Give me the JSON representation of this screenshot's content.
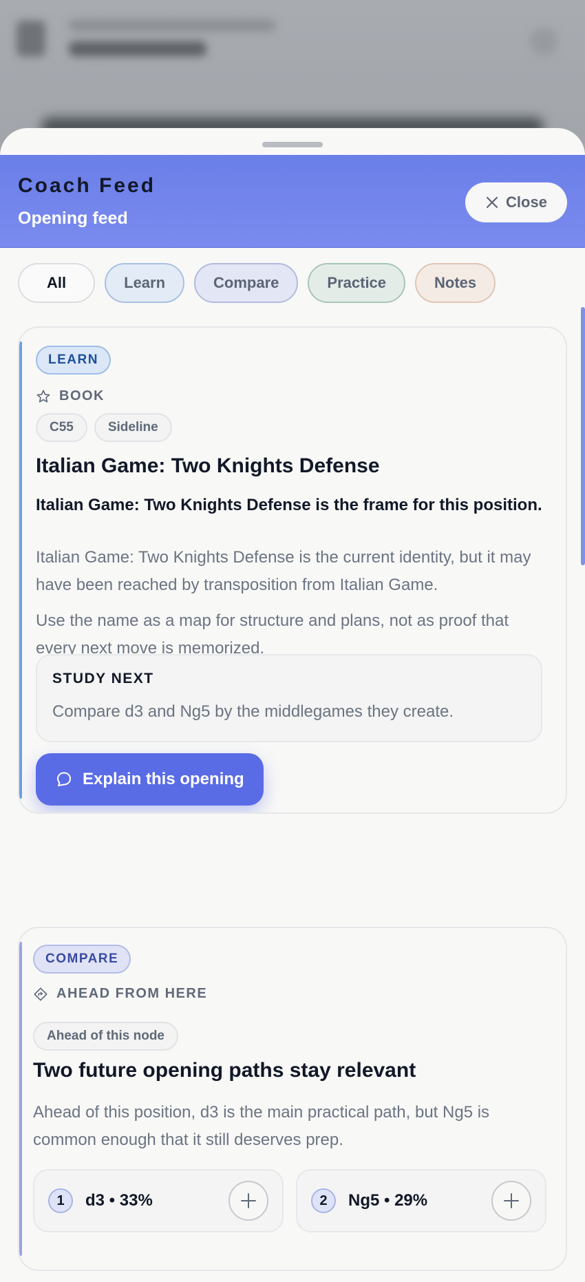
{
  "header": {
    "title": "Coach Feed",
    "subtitle": "Opening feed",
    "close_label": "Close"
  },
  "filters": [
    {
      "label": "All"
    },
    {
      "label": "Learn"
    },
    {
      "label": "Compare"
    },
    {
      "label": "Practice"
    },
    {
      "label": "Notes"
    }
  ],
  "learn_card": {
    "tag": "LEARN",
    "meta": "BOOK",
    "pills": [
      "C55",
      "Sideline"
    ],
    "title": "Italian Game: Two Knights Defense",
    "lead": "Italian Game: Two Knights Defense is the frame for this position.",
    "para1": "Italian Game: Two Knights Defense is the current identity, but it may have been reached by transposition from Italian Game.",
    "para2": "Use the name as a map for structure and plans, not as proof that every next move is memorized.",
    "study_title": "STUDY NEXT",
    "study_text": "Compare d3 and Ng5 by the middlegames they create.",
    "button_label": "Explain this opening"
  },
  "compare_card": {
    "tag": "COMPARE",
    "meta": "AHEAD FROM HERE",
    "pill": "Ahead of this node",
    "title": "Two future opening paths stay relevant",
    "para": "Ahead of this position, d3 is the main practical path, but Ng5 is common enough that it still deserves prep.",
    "paths": [
      {
        "num": "1",
        "label": "d3 • 33%"
      },
      {
        "num": "2",
        "label": "Ng5 • 29%"
      }
    ]
  },
  "colors": {
    "accent": "#5a6be6",
    "header": "#6b7fe9",
    "learn": "#1f4f9a",
    "compare": "#3a4ba0"
  }
}
